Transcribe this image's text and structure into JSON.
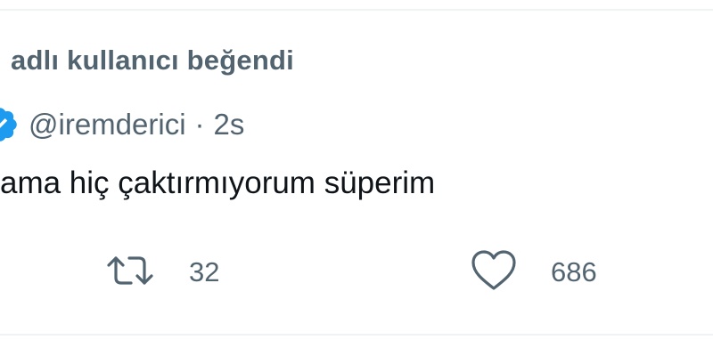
{
  "context": {
    "liked_by_text": "adlı kullanıcı beğendi"
  },
  "tweet": {
    "handle": "@iremderici",
    "separator": "·",
    "time": "2s",
    "text": "ama hiç çaktırmıyorum süperim"
  },
  "actions": {
    "retweet_count": "32",
    "like_count": "686"
  },
  "colors": {
    "secondary_text": "#536471",
    "primary_text": "#0f1419",
    "verified_badge": "#1d9bf0"
  },
  "icons": {
    "verified": "verified-badge-icon",
    "retweet": "retweet-icon",
    "like": "heart-icon"
  }
}
